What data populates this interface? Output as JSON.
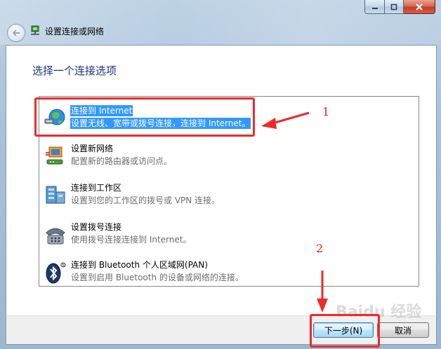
{
  "window": {
    "title": "设置连接或网络",
    "page_heading": "选择一个连接选项"
  },
  "options": [
    {
      "title": "连接到 Internet",
      "description": "设置无线、宽带或拨号连接，连接到 Internet。",
      "icon": "globe-network-icon",
      "selected": true
    },
    {
      "title": "设置新网络",
      "description": "配置新的路由器或访问点。",
      "icon": "router-icon",
      "selected": false
    },
    {
      "title": "连接到工作区",
      "description": "设置到您的工作区的拨号或 VPN 连接。",
      "icon": "workplace-icon",
      "selected": false
    },
    {
      "title": "设置拨号连接",
      "description": "使用拨号连接连接到 Internet。",
      "icon": "dialup-phone-icon",
      "selected": false
    },
    {
      "title": "连接到 Bluetooth 个人区域网(PAN)",
      "description": "设置到启用 Bluetooth 的设备或网络的连接。",
      "icon": "bluetooth-icon",
      "selected": false
    }
  ],
  "buttons": {
    "next": "下一步(N)",
    "cancel": "取消"
  },
  "annotations": {
    "step1": "1",
    "step2": "2",
    "color": "#ee2a2a"
  },
  "watermark": "Baidu 经验",
  "colors": {
    "selection": "#3399ff",
    "heading": "#1e3287"
  }
}
